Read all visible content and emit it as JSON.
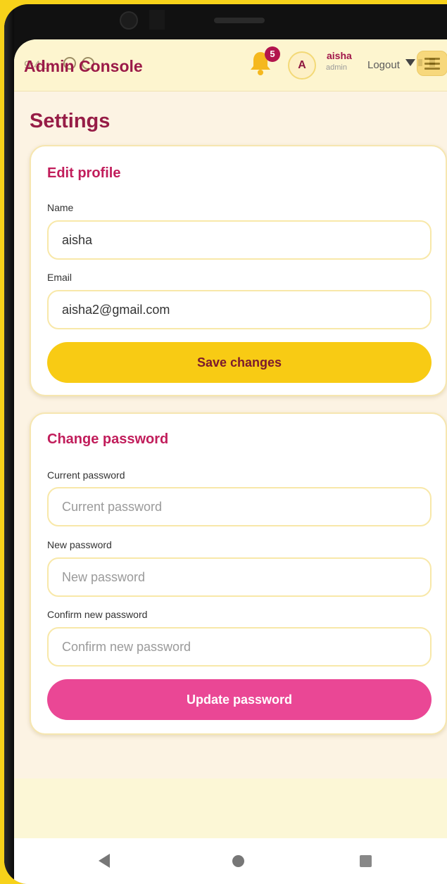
{
  "status": {
    "time": "9:41"
  },
  "header": {
    "app_title": "Admin Console",
    "notification_count": "5",
    "avatar_initial": "A",
    "user_name": "aisha",
    "user_role": "admin",
    "logout_label": "Logout"
  },
  "page": {
    "title": "Settings"
  },
  "edit_profile": {
    "title": "Edit profile",
    "name_label": "Name",
    "name_value": "aisha",
    "email_label": "Email",
    "email_value": "aisha2@gmail.com",
    "save_label": "Save changes"
  },
  "change_password": {
    "title": "Change password",
    "current_label": "Current password",
    "current_placeholder": "Current password",
    "new_label": "New password",
    "new_placeholder": "New password",
    "confirm_label": "Confirm new password",
    "confirm_placeholder": "Confirm new password",
    "update_label": "Update password"
  },
  "colors": {
    "brand": "#961c46",
    "accent_yellow": "#f8cb14",
    "accent_pink": "#ea4795",
    "header_bg": "#fdf5cf",
    "page_bg": "#fcf3e3"
  },
  "icons": {
    "notification": "bell-icon",
    "menu": "hamburger-menu-icon",
    "nav_back": "back-triangle-icon",
    "nav_home": "home-circle-icon",
    "nav_recent": "recent-apps-square-icon"
  }
}
